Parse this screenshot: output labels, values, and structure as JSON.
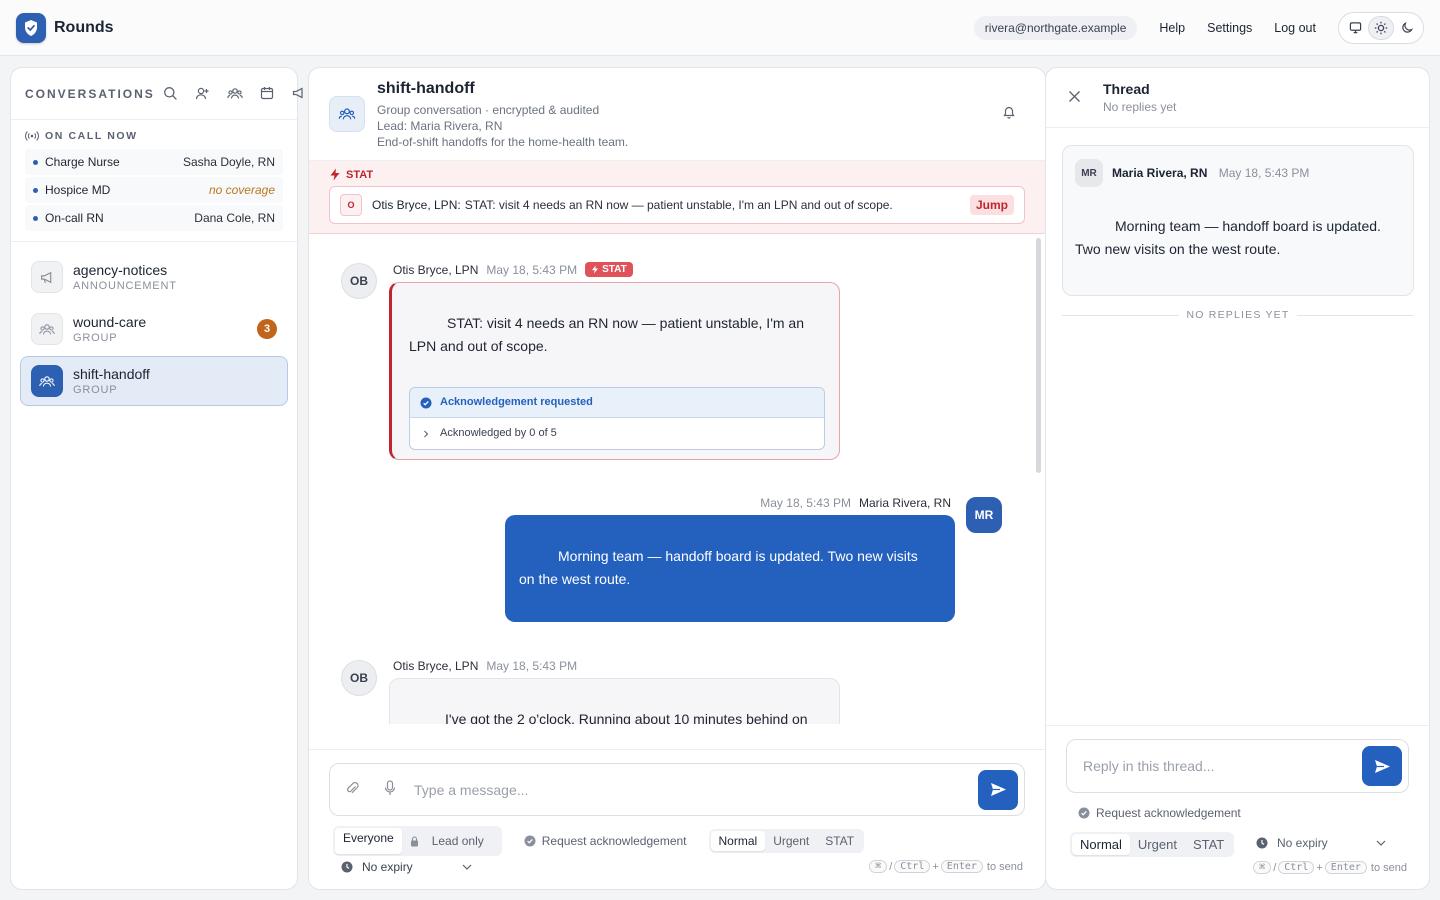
{
  "app": {
    "name": "Rounds"
  },
  "topbar": {
    "email": "rivera@northgate.example",
    "links": [
      "Help",
      "Settings",
      "Log out"
    ]
  },
  "sidebar": {
    "title": "CONVERSATIONS",
    "oncall_title": "ON CALL NOW",
    "oncall": [
      {
        "role": "Charge Nurse",
        "who": "Sasha Doyle, RN"
      },
      {
        "role": "Hospice MD",
        "who": "no coverage"
      },
      {
        "role": "On-call RN",
        "who": "Dana Cole, RN"
      }
    ],
    "conversations": [
      {
        "name": "agency-notices",
        "type": "ANNOUNCEMENT",
        "icon": "megaphone-icon"
      },
      {
        "name": "wound-care",
        "type": "GROUP",
        "badge": "3",
        "icon": "group-icon"
      },
      {
        "name": "shift-handoff",
        "type": "GROUP",
        "icon": "group-icon",
        "active": true
      }
    ]
  },
  "channel": {
    "title": "shift-handoff",
    "sub1": "Group conversation · encrypted & audited",
    "sub2": "Lead: Maria Rivera, RN",
    "sub3": "End-of-shift handoffs for the home-health team."
  },
  "stat_banner": {
    "label": "STAT",
    "avatar": "O",
    "author": "Otis Bryce, LPN:",
    "text": "STAT: visit 4 needs an RN now — patient unstable, I'm an LPN and out of scope.",
    "jump": "Jump"
  },
  "messages": [
    {
      "initials": "OB",
      "author": "Otis Bryce, LPN",
      "time": "May 18, 5:43 PM",
      "chip": "STAT",
      "text": "STAT: visit 4 needs an RN now — patient unstable, I'm an LPN and out of scope.",
      "ack_title": "Acknowledgement requested",
      "ack_count": "Acknowledged by 0 of 5"
    },
    {
      "initials": "MR",
      "author": "Maria Rivera, RN",
      "time": "May 18, 5:43 PM",
      "text": "Morning team — handoff board is updated. Two new visits on the west route."
    },
    {
      "initials": "OB",
      "author": "Otis Bryce, LPN",
      "time": "May 18, 5:43 PM",
      "text": "I've got the 2 o'clock. Running about 10 minutes behind on"
    }
  ],
  "composer": {
    "placeholder": "Type a message...",
    "audience": [
      "Everyone",
      "Lead only"
    ],
    "ack": "Request acknowledgement",
    "priority": [
      "Normal",
      "Urgent",
      "STAT"
    ],
    "expiry": "No expiry",
    "kbd": [
      "⌘",
      "Ctrl",
      "Enter"
    ],
    "hint": "to send"
  },
  "thread": {
    "title": "Thread",
    "sub": "No replies yet",
    "initials": "MR",
    "author": "Maria Rivera, RN",
    "time": "May 18, 5:43 PM",
    "text": "Morning team — handoff board is updated. Two new visits on the west route.",
    "divider": "NO REPLIES YET",
    "placeholder": "Reply in this thread...",
    "ack": "Request acknowledgement",
    "priority": [
      "Normal",
      "Urgent",
      "STAT"
    ],
    "expiry": "No expiry",
    "kbd": [
      "⌘",
      "Ctrl",
      "Enter"
    ],
    "hint": "to send"
  },
  "colors": {
    "accent": "#2461be",
    "stat": "#c0262d",
    "badge": "#c0651a"
  }
}
